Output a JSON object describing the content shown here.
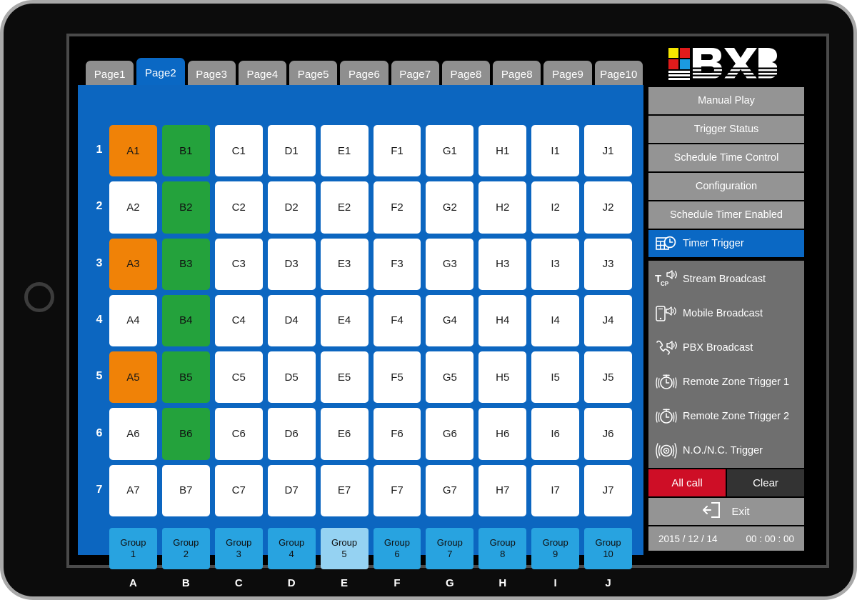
{
  "device": {
    "name": "tablet-frame",
    "home_button": "home-button"
  },
  "brand": {
    "logo_text": "BXB",
    "swatches": [
      "#f5e500",
      "#e01b1b",
      "#e01b1b",
      "#1b9ae0"
    ]
  },
  "tabs": [
    {
      "label": "Page1",
      "active": false
    },
    {
      "label": "Page2",
      "active": true
    },
    {
      "label": "Page3",
      "active": false
    },
    {
      "label": "Page4",
      "active": false
    },
    {
      "label": "Page5",
      "active": false
    },
    {
      "label": "Page6",
      "active": false
    },
    {
      "label": "Page7",
      "active": false
    },
    {
      "label": "Page8",
      "active": false
    },
    {
      "label": "Page8",
      "active": false
    },
    {
      "label": "Page9",
      "active": false
    },
    {
      "label": "Page10",
      "active": false
    }
  ],
  "zone_grid": {
    "row_numbers": [
      "1",
      "2",
      "3",
      "4",
      "5",
      "6",
      "7"
    ],
    "column_labels": [
      "A",
      "B",
      "C",
      "D",
      "E",
      "F",
      "G",
      "H",
      "I",
      "J"
    ],
    "state_colors": {
      "idle": "#ffffff",
      "orange": "#f08207",
      "green": "#24a23c"
    },
    "rows": [
      [
        {
          "label": "A1",
          "state": "orange"
        },
        {
          "label": "B1",
          "state": "green"
        },
        {
          "label": "C1",
          "state": "idle"
        },
        {
          "label": "D1",
          "state": "idle"
        },
        {
          "label": "E1",
          "state": "idle"
        },
        {
          "label": "F1",
          "state": "idle"
        },
        {
          "label": "G1",
          "state": "idle"
        },
        {
          "label": "H1",
          "state": "idle"
        },
        {
          "label": "I1",
          "state": "idle"
        },
        {
          "label": "J1",
          "state": "idle"
        }
      ],
      [
        {
          "label": "A2",
          "state": "idle"
        },
        {
          "label": "B2",
          "state": "green"
        },
        {
          "label": "C2",
          "state": "idle"
        },
        {
          "label": "D2",
          "state": "idle"
        },
        {
          "label": "E2",
          "state": "idle"
        },
        {
          "label": "F2",
          "state": "idle"
        },
        {
          "label": "G2",
          "state": "idle"
        },
        {
          "label": "H2",
          "state": "idle"
        },
        {
          "label": "I2",
          "state": "idle"
        },
        {
          "label": "J2",
          "state": "idle"
        }
      ],
      [
        {
          "label": "A3",
          "state": "orange"
        },
        {
          "label": "B3",
          "state": "green"
        },
        {
          "label": "C3",
          "state": "idle"
        },
        {
          "label": "D3",
          "state": "idle"
        },
        {
          "label": "E3",
          "state": "idle"
        },
        {
          "label": "F3",
          "state": "idle"
        },
        {
          "label": "G3",
          "state": "idle"
        },
        {
          "label": "H3",
          "state": "idle"
        },
        {
          "label": "I3",
          "state": "idle"
        },
        {
          "label": "J3",
          "state": "idle"
        }
      ],
      [
        {
          "label": "A4",
          "state": "idle"
        },
        {
          "label": "B4",
          "state": "green"
        },
        {
          "label": "C4",
          "state": "idle"
        },
        {
          "label": "D4",
          "state": "idle"
        },
        {
          "label": "E4",
          "state": "idle"
        },
        {
          "label": "F4",
          "state": "idle"
        },
        {
          "label": "G4",
          "state": "idle"
        },
        {
          "label": "H4",
          "state": "idle"
        },
        {
          "label": "I4",
          "state": "idle"
        },
        {
          "label": "J4",
          "state": "idle"
        }
      ],
      [
        {
          "label": "A5",
          "state": "orange"
        },
        {
          "label": "B5",
          "state": "green"
        },
        {
          "label": "C5",
          "state": "idle"
        },
        {
          "label": "D5",
          "state": "idle"
        },
        {
          "label": "E5",
          "state": "idle"
        },
        {
          "label": "F5",
          "state": "idle"
        },
        {
          "label": "G5",
          "state": "idle"
        },
        {
          "label": "H5",
          "state": "idle"
        },
        {
          "label": "I5",
          "state": "idle"
        },
        {
          "label": "J5",
          "state": "idle"
        }
      ],
      [
        {
          "label": "A6",
          "state": "idle"
        },
        {
          "label": "B6",
          "state": "green"
        },
        {
          "label": "C6",
          "state": "idle"
        },
        {
          "label": "D6",
          "state": "idle"
        },
        {
          "label": "E6",
          "state": "idle"
        },
        {
          "label": "F6",
          "state": "idle"
        },
        {
          "label": "G6",
          "state": "idle"
        },
        {
          "label": "H6",
          "state": "idle"
        },
        {
          "label": "I6",
          "state": "idle"
        },
        {
          "label": "J6",
          "state": "idle"
        }
      ],
      [
        {
          "label": "A7",
          "state": "idle"
        },
        {
          "label": "B7",
          "state": "idle"
        },
        {
          "label": "C7",
          "state": "idle"
        },
        {
          "label": "D7",
          "state": "idle"
        },
        {
          "label": "E7",
          "state": "idle"
        },
        {
          "label": "F7",
          "state": "idle"
        },
        {
          "label": "G7",
          "state": "idle"
        },
        {
          "label": "H7",
          "state": "idle"
        },
        {
          "label": "I7",
          "state": "idle"
        },
        {
          "label": "J7",
          "state": "idle"
        }
      ]
    ]
  },
  "groups": [
    {
      "name": "Group",
      "number": "1",
      "selected": false
    },
    {
      "name": "Group",
      "number": "2",
      "selected": false
    },
    {
      "name": "Group",
      "number": "3",
      "selected": false
    },
    {
      "name": "Group",
      "number": "4",
      "selected": false
    },
    {
      "name": "Group",
      "number": "5",
      "selected": true
    },
    {
      "name": "Group",
      "number": "6",
      "selected": false
    },
    {
      "name": "Group",
      "number": "7",
      "selected": false
    },
    {
      "name": "Group",
      "number": "8",
      "selected": false
    },
    {
      "name": "Group",
      "number": "9",
      "selected": false
    },
    {
      "name": "Group",
      "number": "10",
      "selected": false
    }
  ],
  "menu": {
    "top_items": [
      {
        "label": "Manual Play",
        "icon": null,
        "active": false
      },
      {
        "label": "Trigger Status",
        "icon": null,
        "active": false
      },
      {
        "label": "Schedule Time Control",
        "icon": null,
        "active": false
      },
      {
        "label": "Configuration",
        "icon": null,
        "active": false
      },
      {
        "label": "Schedule Timer Enabled",
        "icon": null,
        "active": false
      },
      {
        "label": "Timer Trigger",
        "icon": "calendar-clock-icon",
        "active": true
      }
    ],
    "trigger_items": [
      {
        "label": "Stream Broadcast",
        "icon": "tcp-broadcast-icon"
      },
      {
        "label": "Mobile Broadcast",
        "icon": "mobile-broadcast-icon"
      },
      {
        "label": "PBX Broadcast",
        "icon": "pbx-broadcast-icon"
      },
      {
        "label": "Remote Zone Trigger 1",
        "icon": "alarm-clock-icon"
      },
      {
        "label": "Remote Zone Trigger 2",
        "icon": "alarm-clock-icon"
      },
      {
        "label": "N.O./N.C. Trigger",
        "icon": "siren-icon"
      }
    ]
  },
  "actions": {
    "all_call": "All call",
    "clear": "Clear",
    "exit": "Exit",
    "exit_icon": "exit-arrow-icon"
  },
  "status_bar": {
    "date": "2015 / 12 / 14",
    "time": "00 : 00 : 00"
  },
  "colors": {
    "panel_blue": "#0c66c0",
    "tab_active": "#0a68c4",
    "tab_idle": "#8f8f8f",
    "menu_gray": "#949494",
    "trigger_gray": "#6f6f6f",
    "all_call_red": "#ce0e26",
    "clear_dark": "#333333",
    "group_blue": "#28a3e0",
    "group_selected": "#95d2f2"
  }
}
